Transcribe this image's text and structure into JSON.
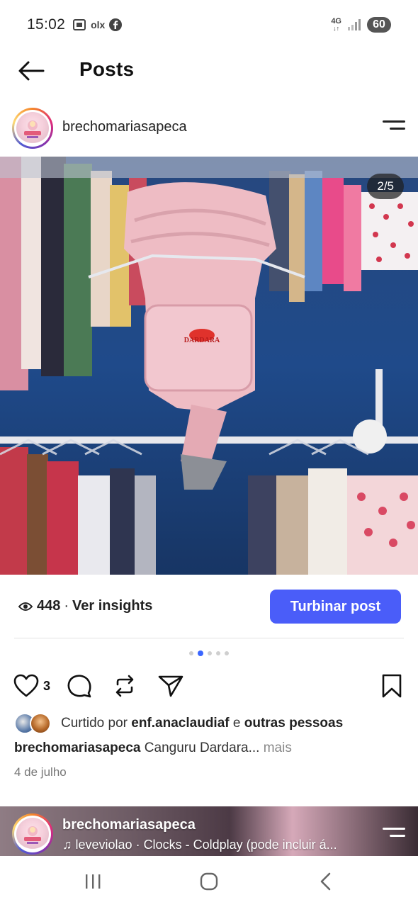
{
  "status_bar": {
    "time": "15:02",
    "notification_icons": [
      "screenshot-icon",
      "olx-icon",
      "facebook-icon"
    ],
    "olx_label": "olx",
    "network": "4G",
    "battery": "60"
  },
  "top_bar": {
    "title": "Posts"
  },
  "post": {
    "username": "brechomariasapeca",
    "image_counter": "2/5",
    "image_brand_text": "DARDARA",
    "views": "448",
    "separator": "·",
    "insights_label": "Ver insights",
    "boost_label": "Turbinar post",
    "carousel_total": 5,
    "carousel_active_index": 1,
    "like_count": "3",
    "liked_by_prefix": "Curtido por",
    "liked_by_user": "enf.anaclaudiaf",
    "liked_by_conj": "e",
    "liked_by_suffix": "outras pessoas",
    "caption_user": "brechomariasapeca",
    "caption_text": "Canguru Dardara...",
    "caption_more": "mais",
    "date": "4 de julho"
  },
  "next_post": {
    "username": "brechomariasapeca",
    "music": "leveviolao · Clocks - Coldplay (pode incluir á..."
  },
  "colors": {
    "boost_button": "#4a5df9",
    "active_dot": "#3a66ff"
  }
}
